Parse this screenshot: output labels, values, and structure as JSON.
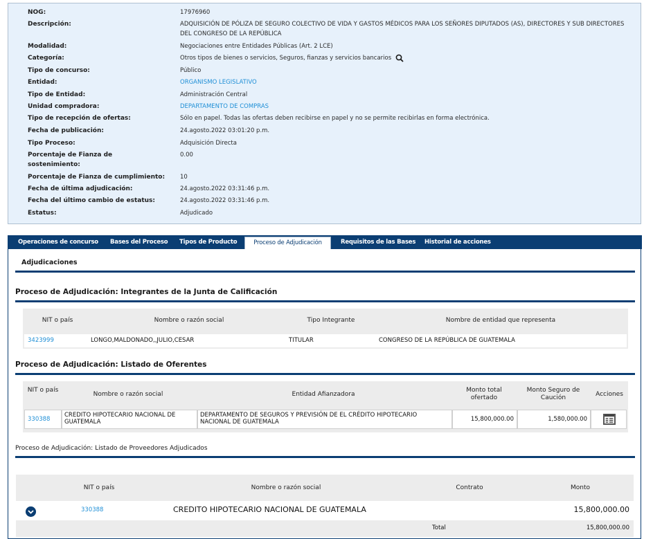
{
  "info": {
    "nog_label": "NOG:",
    "nog_value": "17976960",
    "descripcion_label": "Descripción:",
    "descripcion_value": "ADQUISICIÓN DE PÓLIZA DE SEGURO COLECTIVO DE VIDA Y GASTOS MÉDICOS PARA LOS SEÑORES DIPUTADOS (AS), DIRECTORES Y SUB DIRECTORES DEL CONGRESO DE LA REPÚBLICA",
    "modalidad_label": "Modalidad:",
    "modalidad_value": "Negociaciones entre Entidades Públicas (Art. 2 LCE)",
    "categoria_label": "Categoría:",
    "categoria_value": "Otros tipos de bienes o servicios, Seguros, fianzas y servicios bancarios",
    "tipo_concurso_label": "Tipo de concurso:",
    "tipo_concurso_value": "Público",
    "entidad_label": "Entidad:",
    "entidad_value": "ORGANISMO LEGISLATIVO",
    "tipo_entidad_label": "Tipo de Entidad:",
    "tipo_entidad_value": "Administración Central",
    "unidad_label": "Unidad compradora:",
    "unidad_value": "DEPARTAMENTO DE COMPRAS",
    "recepcion_label": "Tipo de recepción de ofertas:",
    "recepcion_value": "Sólo en papel. Todas las ofertas deben recibirse en papel y no se permite recibirlas en forma electrónica.",
    "publicacion_label": "Fecha de publicación:",
    "publicacion_value": "24.agosto.2022 03:01:20 p.m.",
    "tipo_proceso_label": "Tipo Proceso:",
    "tipo_proceso_value": "Adquisición Directa",
    "fianza_sost_label": "Porcentaje de Fianza de sostenimiento:",
    "fianza_sost_value": "0.00",
    "fianza_cump_label": "Porcentaje de Fianza de cumplimiento:",
    "fianza_cump_value": "10",
    "ultima_adj_label": "Fecha de última adjudicación:",
    "ultima_adj_value": "24.agosto.2022 03:31:46 p.m.",
    "ultimo_cambio_label": "Fecha del último cambio de estatus:",
    "ultimo_cambio_value": "24.agosto.2022 03:31:46 p.m.",
    "estatus_label": "Estatus:",
    "estatus_value": "Adjudicado"
  },
  "tabs": [
    "Operaciones de concurso",
    "Bases del Proceso",
    "Tipos de Producto",
    "Proceso de Adjudicación",
    "Requisitos de las Bases",
    "Historial de acciones"
  ],
  "subtab": "Adjudicaciones",
  "junta": {
    "title": "Proceso de Adjudicación: Integrantes de la Junta de Calificación",
    "headers": [
      "NIT o país",
      "Nombre o razón social",
      "Tipo Integrante",
      "Nombre de entidad que representa"
    ],
    "rows": [
      [
        "3423999",
        "LONGO,MALDONADO,,JULIO,CESAR",
        "TITULAR",
        "CONGRESO DE LA REPÚBLICA DE GUATEMALA"
      ]
    ]
  },
  "oferentes": {
    "title": "Proceso de Adjudicación: Listado de Oferentes",
    "headers": [
      "NIT o país",
      "Nombre o razón social",
      "Entidad Afianzadora",
      "Monto total ofertado",
      "Monto Seguro de Caución",
      "Acciones"
    ],
    "rows": [
      [
        "330388",
        "CREDITO HIPOTECARIO NACIONAL DE GUATEMALA",
        "DEPARTAMENTO DE SEGUROS Y PREVISIÓN DE EL CRÉDITO HIPOTECARIO NACIONAL DE GUATEMALA",
        "15,800,000.00",
        "1,580,000.00"
      ]
    ]
  },
  "adjudicados": {
    "title": "Proceso de Adjudicación: Listado de Proveedores Adjudicados",
    "headers": [
      "NIT o país",
      "Nombre o razón social",
      "Contrato",
      "Monto"
    ],
    "rows": [
      [
        "330388",
        "CREDITO HIPOTECARIO NACIONAL DE GUATEMALA",
        "",
        "15,800,000.00"
      ]
    ],
    "total_label": "Total",
    "total_value": "15,800,000.00"
  },
  "icons": {
    "search": "search-icon",
    "actions": "table-detail-icon",
    "expand": "chevron-down-circle-icon"
  },
  "colors": {
    "navy": "#0b3e73",
    "link": "#1f8fd6",
    "info_bg": "#e7f1fb",
    "table_header_bg": "#ececec"
  }
}
